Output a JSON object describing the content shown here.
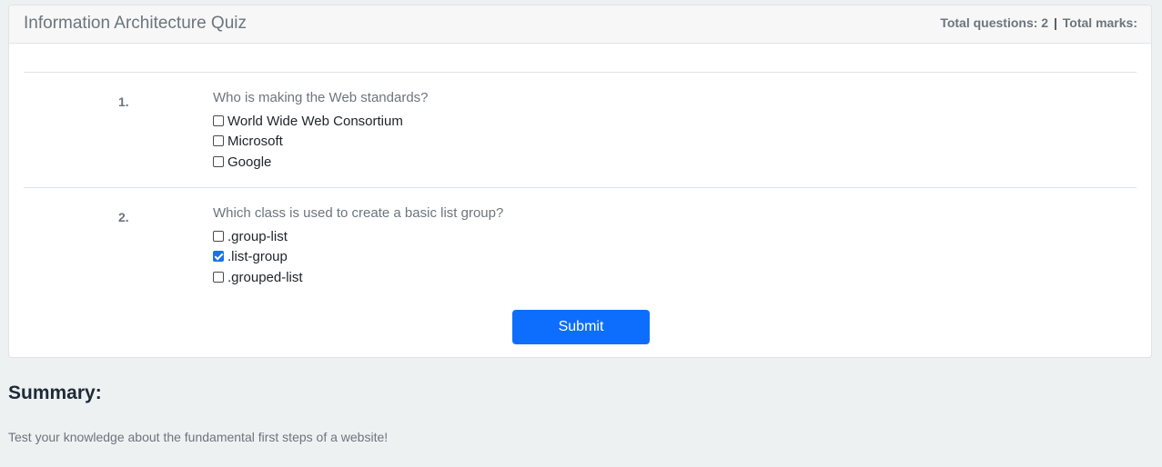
{
  "quiz": {
    "title": "Information Architecture Quiz",
    "total_questions_label": "Total questions: 2",
    "separator": "|",
    "total_marks_label": "Total marks:",
    "submit_label": "Submit"
  },
  "questions": [
    {
      "number": "1.",
      "text": "Who is making the Web standards?",
      "options": [
        {
          "label": "World Wide Web Consortium",
          "checked": false
        },
        {
          "label": "Microsoft",
          "checked": false
        },
        {
          "label": "Google",
          "checked": false
        }
      ]
    },
    {
      "number": "2.",
      "text": "Which class is used to create a basic list group?",
      "options": [
        {
          "label": ".group-list",
          "checked": false
        },
        {
          "label": ".list-group",
          "checked": true
        },
        {
          "label": ".grouped-list",
          "checked": false
        }
      ]
    }
  ],
  "summary": {
    "heading": "Summary:",
    "text": "Test your knowledge about the fundamental first steps of a website!"
  },
  "colors": {
    "primary": "#0d6efd",
    "muted": "#6c757d",
    "background": "#eef1f2"
  }
}
